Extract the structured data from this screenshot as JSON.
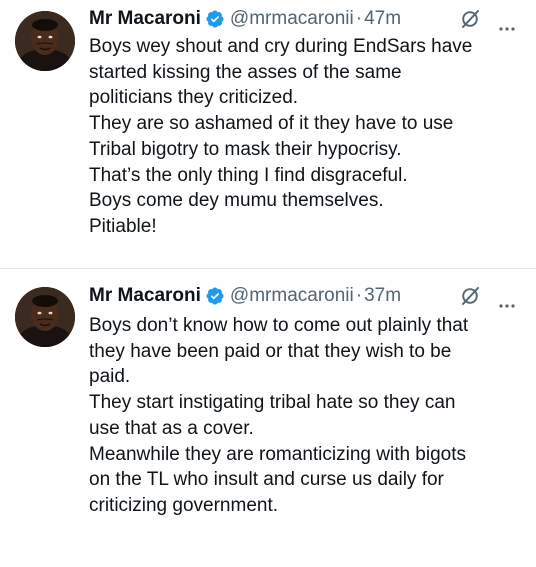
{
  "tweets": [
    {
      "author": {
        "name": "Mr Macaroni",
        "handle": "@mrmacaronii",
        "verified": true
      },
      "separator": "·",
      "time": "47m",
      "lines": [
        "Boys wey shout and cry during EndSars have",
        "started kissing the asses of the same",
        "politicians they criticized.",
        "They are so ashamed of it they have to use",
        "Tribal bigotry to mask their hypocrisy.",
        "That’s the only thing I find disgraceful.",
        "Boys come dey mumu themselves.",
        "Pitiable!"
      ]
    },
    {
      "author": {
        "name": "Mr Macaroni",
        "handle": "@mrmacaronii",
        "verified": true
      },
      "separator": "·",
      "time": "37m",
      "lines": [
        "Boys don’t know how to come out plainly that",
        "they have been paid or that they wish to be",
        "paid.",
        "They start instigating tribal hate so they can",
        "use that as a cover.",
        "Meanwhile they are romanticizing with bigots",
        "on the TL who insult and curse us daily for",
        "criticizing government."
      ]
    }
  ],
  "colors": {
    "text_primary": "#0f1419",
    "text_secondary": "#536471",
    "verified_blue": "#1d9bf0",
    "divider": "#e6e9eb"
  },
  "icons": [
    "verified-badge-icon",
    "grok-icon",
    "more-options-icon"
  ]
}
